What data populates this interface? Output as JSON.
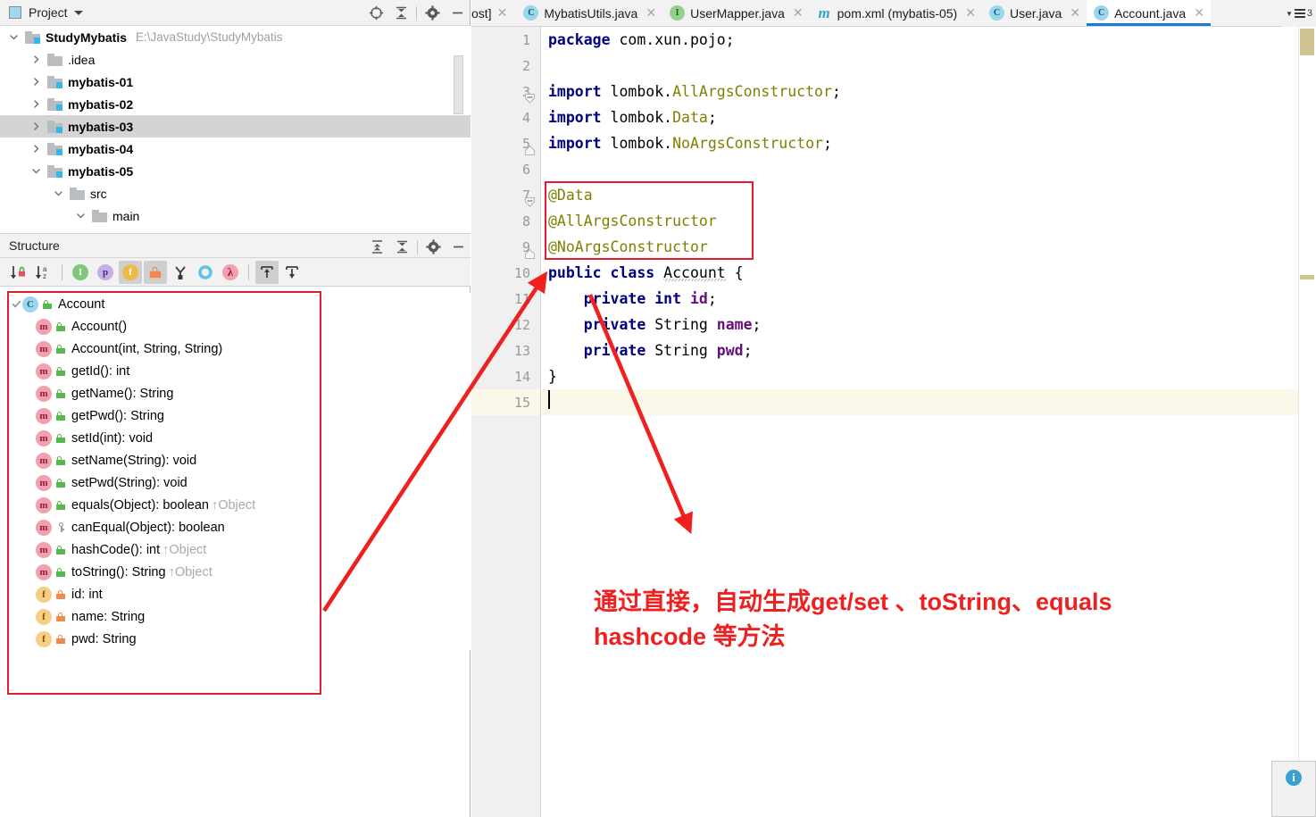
{
  "project_panel": {
    "title": "Project",
    "icon": "project-window-icon",
    "actions": [
      {
        "name": "locate-icon",
        "glyph": "locate"
      },
      {
        "name": "collapse-all-icon",
        "glyph": "collapse"
      },
      {
        "name": "gear-icon",
        "glyph": "gear"
      },
      {
        "name": "hide-icon",
        "glyph": "minus"
      }
    ],
    "tree": [
      {
        "label": "StudyMybatis",
        "path": "E:\\JavaStudy\\StudyMybatis",
        "depth": 0,
        "expanded": true,
        "icon": "module-folder-icon",
        "bold": true,
        "selected": false
      },
      {
        "label": ".idea",
        "path": "",
        "depth": 1,
        "expanded": false,
        "icon": "folder-icon",
        "bold": false,
        "selected": false
      },
      {
        "label": "mybatis-01",
        "path": "",
        "depth": 1,
        "expanded": false,
        "icon": "module-folder-icon",
        "bold": true,
        "selected": false
      },
      {
        "label": "mybatis-02",
        "path": "",
        "depth": 1,
        "expanded": false,
        "icon": "module-folder-icon",
        "bold": true,
        "selected": false
      },
      {
        "label": "mybatis-03",
        "path": "",
        "depth": 1,
        "expanded": false,
        "icon": "module-folder-icon",
        "bold": true,
        "selected": true
      },
      {
        "label": "mybatis-04",
        "path": "",
        "depth": 1,
        "expanded": false,
        "icon": "module-folder-icon",
        "bold": true,
        "selected": false
      },
      {
        "label": "mybatis-05",
        "path": "",
        "depth": 1,
        "expanded": true,
        "icon": "module-folder-icon",
        "bold": true,
        "selected": false
      },
      {
        "label": "src",
        "path": "",
        "depth": 2,
        "expanded": true,
        "icon": "folder-icon",
        "bold": false,
        "selected": false
      },
      {
        "label": "main",
        "path": "",
        "depth": 3,
        "expanded": true,
        "icon": "folder-icon",
        "bold": false,
        "selected": false
      }
    ]
  },
  "structure_panel": {
    "title": "Structure",
    "actions": [
      {
        "name": "expand-all-icon"
      },
      {
        "name": "collapse-all-icon"
      },
      {
        "name": "gear-icon"
      },
      {
        "name": "hide-icon"
      }
    ],
    "toolbar": [
      {
        "name": "sort-by-visibility-button",
        "active": false
      },
      {
        "name": "sort-alphabetically-button",
        "active": false
      },
      {
        "name": "show-inherited-button",
        "active": false,
        "letter": "I",
        "color": "#7dc87a"
      },
      {
        "name": "show-properties-button",
        "active": false,
        "letter": "p",
        "color": "#c6aee8"
      },
      {
        "name": "show-fields-button",
        "active": true,
        "letter": "f",
        "color": "#efb949"
      },
      {
        "name": "show-non-public-button",
        "active": true,
        "letter": "lock",
        "color": "#f08a4b"
      },
      {
        "name": "show-anonymous-classes-button",
        "active": false
      },
      {
        "name": "group-by-method-button",
        "active": false,
        "color": "#5bc4e8"
      },
      {
        "name": "show-lambdas-button",
        "active": false,
        "letter": "λ",
        "color": "#f2a0b0"
      },
      {
        "name": "autoscroll-to-source-button",
        "active": true
      },
      {
        "name": "autoscroll-from-source-button",
        "active": false
      }
    ],
    "tree": [
      {
        "label": "Account",
        "depth": 0,
        "kind": "class",
        "vis": "public",
        "override": "",
        "expanded": true,
        "checked": true
      },
      {
        "label": "Account()",
        "depth": 1,
        "kind": "method",
        "vis": "public",
        "override": ""
      },
      {
        "label": "Account(int, String, String)",
        "depth": 1,
        "kind": "method",
        "vis": "public",
        "override": ""
      },
      {
        "label": "getId(): int",
        "depth": 1,
        "kind": "method",
        "vis": "public",
        "override": ""
      },
      {
        "label": "getName(): String",
        "depth": 1,
        "kind": "method",
        "vis": "public",
        "override": ""
      },
      {
        "label": "getPwd(): String",
        "depth": 1,
        "kind": "method",
        "vis": "public",
        "override": ""
      },
      {
        "label": "setId(int): void",
        "depth": 1,
        "kind": "method",
        "vis": "public",
        "override": ""
      },
      {
        "label": "setName(String): void",
        "depth": 1,
        "kind": "method",
        "vis": "public",
        "override": ""
      },
      {
        "label": "setPwd(String): void",
        "depth": 1,
        "kind": "method",
        "vis": "public",
        "override": ""
      },
      {
        "label": "equals(Object): boolean",
        "depth": 1,
        "kind": "method",
        "vis": "public",
        "override": "↑Object"
      },
      {
        "label": "canEqual(Object): boolean",
        "depth": 1,
        "kind": "method",
        "vis": "protected",
        "override": ""
      },
      {
        "label": "hashCode(): int",
        "depth": 1,
        "kind": "method",
        "vis": "public",
        "override": "↑Object"
      },
      {
        "label": "toString(): String",
        "depth": 1,
        "kind": "method",
        "vis": "public",
        "override": "↑Object"
      },
      {
        "label": "id: int",
        "depth": 1,
        "kind": "field",
        "vis": "private",
        "override": ""
      },
      {
        "label": "name: String",
        "depth": 1,
        "kind": "field",
        "vis": "private",
        "override": ""
      },
      {
        "label": "pwd: String",
        "depth": 1,
        "kind": "field",
        "vis": "private",
        "override": ""
      }
    ]
  },
  "editor": {
    "tab_strip_truncated_label": "ost]",
    "tabs": [
      {
        "label": "MybatisUtils.java",
        "icon": "class-icon",
        "icon_kind": "c",
        "active": false,
        "closable": true
      },
      {
        "label": "UserMapper.java",
        "icon": "interface-icon",
        "icon_kind": "i",
        "active": false,
        "closable": true
      },
      {
        "label": "pom.xml (mybatis-05)",
        "icon": "maven-icon",
        "icon_kind": "m",
        "active": false,
        "closable": true
      },
      {
        "label": "User.java",
        "icon": "class-icon",
        "icon_kind": "c",
        "active": false,
        "closable": true
      },
      {
        "label": "Account.java",
        "icon": "class-icon",
        "icon_kind": "c",
        "active": true,
        "closable": true
      }
    ],
    "tab_overflow_count": "3",
    "line_numbers": [
      "1",
      "2",
      "3",
      "4",
      "5",
      "6",
      "7",
      "8",
      "9",
      "10",
      "11",
      "12",
      "13",
      "14",
      "15"
    ],
    "current_line": "15",
    "code_lines": [
      {
        "n": "1",
        "tokens": [
          {
            "t": "package",
            "c": "kw"
          },
          {
            "t": " com.xun.pojo;",
            "c": "pl"
          }
        ]
      },
      {
        "n": "2",
        "tokens": []
      },
      {
        "n": "3",
        "tokens": [
          {
            "t": "import",
            "c": "kw"
          },
          {
            "t": " lombok.",
            "c": "pl"
          },
          {
            "t": "AllArgsConstructor",
            "c": "cls-ref"
          },
          {
            "t": ";",
            "c": "pl"
          }
        ]
      },
      {
        "n": "4",
        "tokens": [
          {
            "t": "import",
            "c": "kw"
          },
          {
            "t": " lombok.",
            "c": "pl"
          },
          {
            "t": "Data",
            "c": "cls-ref"
          },
          {
            "t": ";",
            "c": "pl"
          }
        ]
      },
      {
        "n": "5",
        "tokens": [
          {
            "t": "import",
            "c": "kw"
          },
          {
            "t": " lombok.",
            "c": "pl"
          },
          {
            "t": "NoArgsConstructor",
            "c": "cls-ref"
          },
          {
            "t": ";",
            "c": "pl"
          }
        ]
      },
      {
        "n": "6",
        "tokens": []
      },
      {
        "n": "7",
        "tokens": [
          {
            "t": "@Data",
            "c": "ann"
          }
        ]
      },
      {
        "n": "8",
        "tokens": [
          {
            "t": "@AllArgsConstructor",
            "c": "ann"
          }
        ]
      },
      {
        "n": "9",
        "tokens": [
          {
            "t": "@NoArgsConstructor",
            "c": "ann"
          }
        ]
      },
      {
        "n": "10",
        "tokens": [
          {
            "t": "public class",
            "c": "kw"
          },
          {
            "t": " ",
            "c": "pl"
          },
          {
            "t": "Account",
            "c": "warnsq"
          },
          {
            "t": " {",
            "c": "pl"
          }
        ]
      },
      {
        "n": "11",
        "tokens": [
          {
            "t": "    ",
            "c": "pl"
          },
          {
            "t": "private int",
            "c": "kw"
          },
          {
            "t": " ",
            "c": "pl"
          },
          {
            "t": "id",
            "c": "fld-ref"
          },
          {
            "t": ";",
            "c": "pl"
          }
        ]
      },
      {
        "n": "12",
        "tokens": [
          {
            "t": "    ",
            "c": "pl"
          },
          {
            "t": "private",
            "c": "kw"
          },
          {
            "t": " String ",
            "c": "pl"
          },
          {
            "t": "name",
            "c": "fld-ref"
          },
          {
            "t": ";",
            "c": "pl"
          }
        ]
      },
      {
        "n": "13",
        "tokens": [
          {
            "t": "    ",
            "c": "pl"
          },
          {
            "t": "private",
            "c": "kw"
          },
          {
            "t": " String ",
            "c": "pl"
          },
          {
            "t": "pwd",
            "c": "fld-ref"
          },
          {
            "t": ";",
            "c": "pl"
          }
        ]
      },
      {
        "n": "14",
        "tokens": [
          {
            "t": "}",
            "c": "pl"
          }
        ]
      },
      {
        "n": "15",
        "tokens": []
      }
    ]
  },
  "annotation": {
    "note_line1": "通过直接，自动生成get/set 、toString、equals",
    "note_line2": "hashcode 等方法",
    "color": "#ee2020",
    "boxes": [
      {
        "name": "structure-highlight-box"
      },
      {
        "name": "annotations-highlight-box"
      }
    ]
  },
  "status": {
    "info_icon_label": "i"
  },
  "colors": {
    "accent_blue": "#1a7ad4",
    "annotation_red": "#e8192c",
    "keyword_navy": "#000080",
    "annotation_olive": "#808000",
    "field_purple": "#660e7a",
    "current_line_bg": "#fcf8e9"
  }
}
